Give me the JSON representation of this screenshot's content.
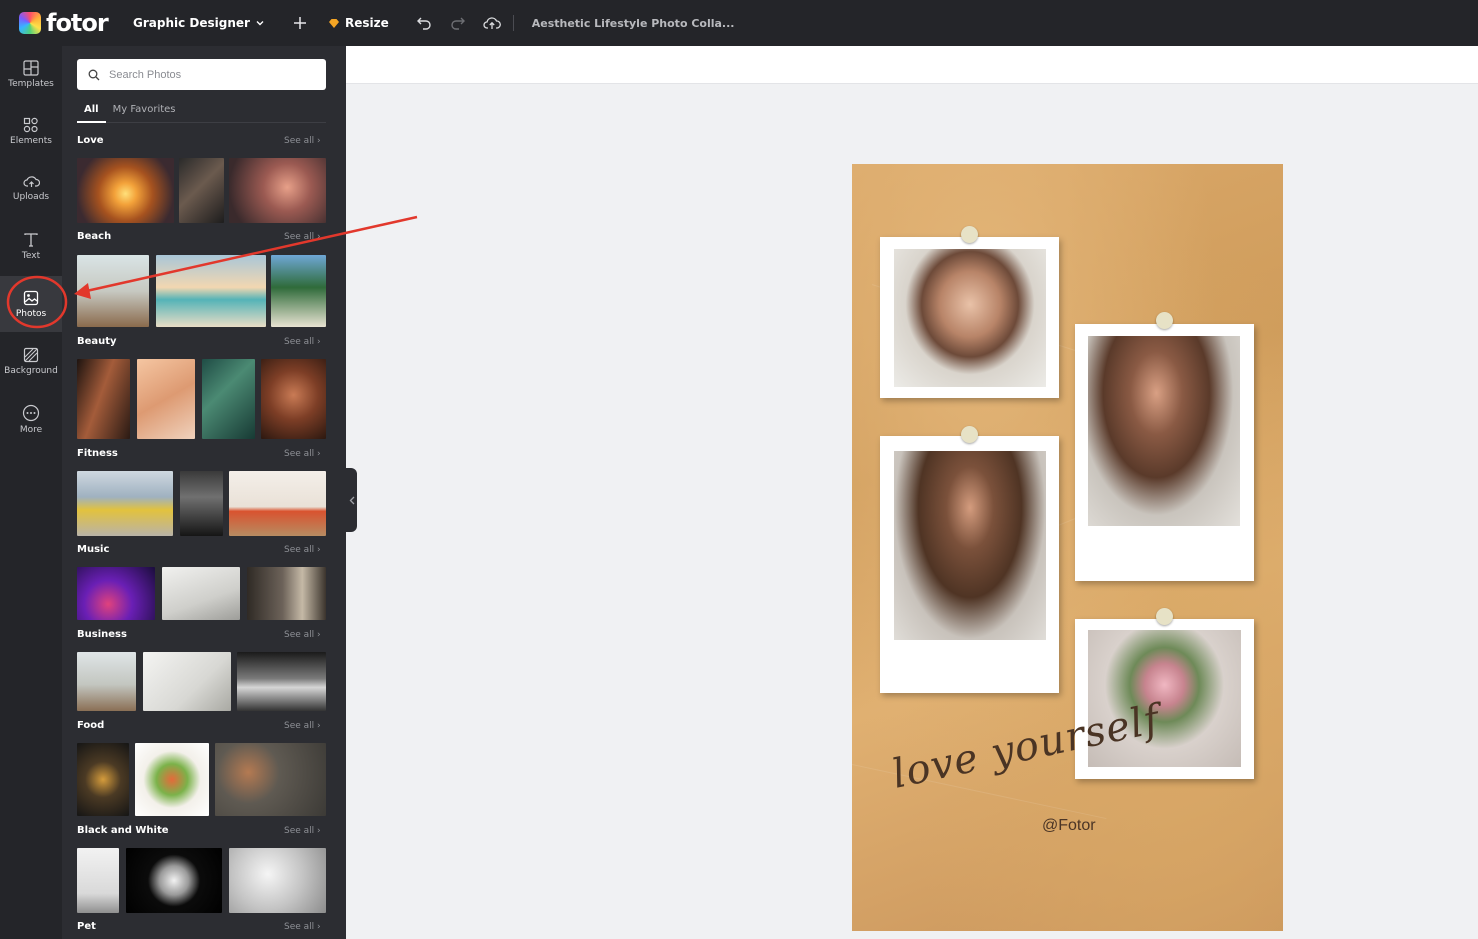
{
  "topbar": {
    "logo_text": "fotor",
    "workspace_label": "Graphic Designer",
    "resize_label": "Resize",
    "document_title": "Aesthetic Lifestyle Photo Colla..."
  },
  "rail": {
    "items": [
      {
        "label": "Templates",
        "icon": "templates-icon"
      },
      {
        "label": "Elements",
        "icon": "elements-icon"
      },
      {
        "label": "Uploads",
        "icon": "upload-cloud-icon"
      },
      {
        "label": "Text",
        "icon": "text-icon"
      },
      {
        "label": "Photos",
        "icon": "photo-icon",
        "active": true
      },
      {
        "label": "Background",
        "icon": "background-icon"
      },
      {
        "label": "More",
        "icon": "more-icon"
      }
    ]
  },
  "panel": {
    "search_placeholder": "Search Photos",
    "tabs": [
      "All",
      "My Favorites"
    ],
    "see_all_label": "See all",
    "sections": [
      {
        "title": "Love"
      },
      {
        "title": "Beach"
      },
      {
        "title": "Beauty"
      },
      {
        "title": "Fitness"
      },
      {
        "title": "Music"
      },
      {
        "title": "Business"
      },
      {
        "title": "Food"
      },
      {
        "title": "Black and White"
      },
      {
        "title": "Pet"
      }
    ]
  },
  "poster": {
    "script_text": "love yourself",
    "handle_text": "@Fotor"
  },
  "colors": {
    "topbar": "#242529",
    "panel": "#2c2d32",
    "annotation_red": "#e2382c",
    "poster_tan": "#d8a766"
  }
}
